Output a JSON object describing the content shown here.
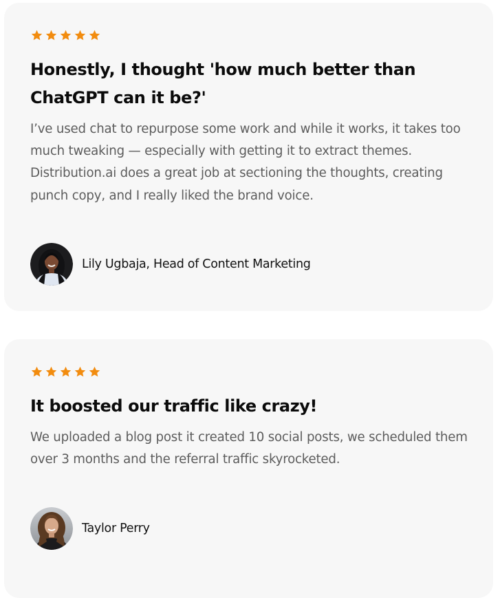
{
  "colors": {
    "card_background": "#f7f7f7",
    "star": "#f28c0f",
    "headline": "#0b0b0b",
    "body_text": "#5c5c5c"
  },
  "testimonials": [
    {
      "rating": 5,
      "headline": "Honestly, I thought 'how much better than ChatGPT can it be?'",
      "body": "I’ve used chat to repurpose some work and while it works, it takes too much tweaking — especially with getting it to extract themes. Distribution.ai does a great job at sectioning the thoughts, creating punch copy, and I really liked the brand voice.",
      "author": "Lily Ugbaja, Head of Content Marketing"
    },
    {
      "rating": 5,
      "headline": "It boosted our traffic like crazy!",
      "body": "We uploaded a blog post it created 10 social posts, we scheduled them over 3 months and the referral traffic skyrocketed.",
      "author": "Taylor Perry"
    }
  ]
}
